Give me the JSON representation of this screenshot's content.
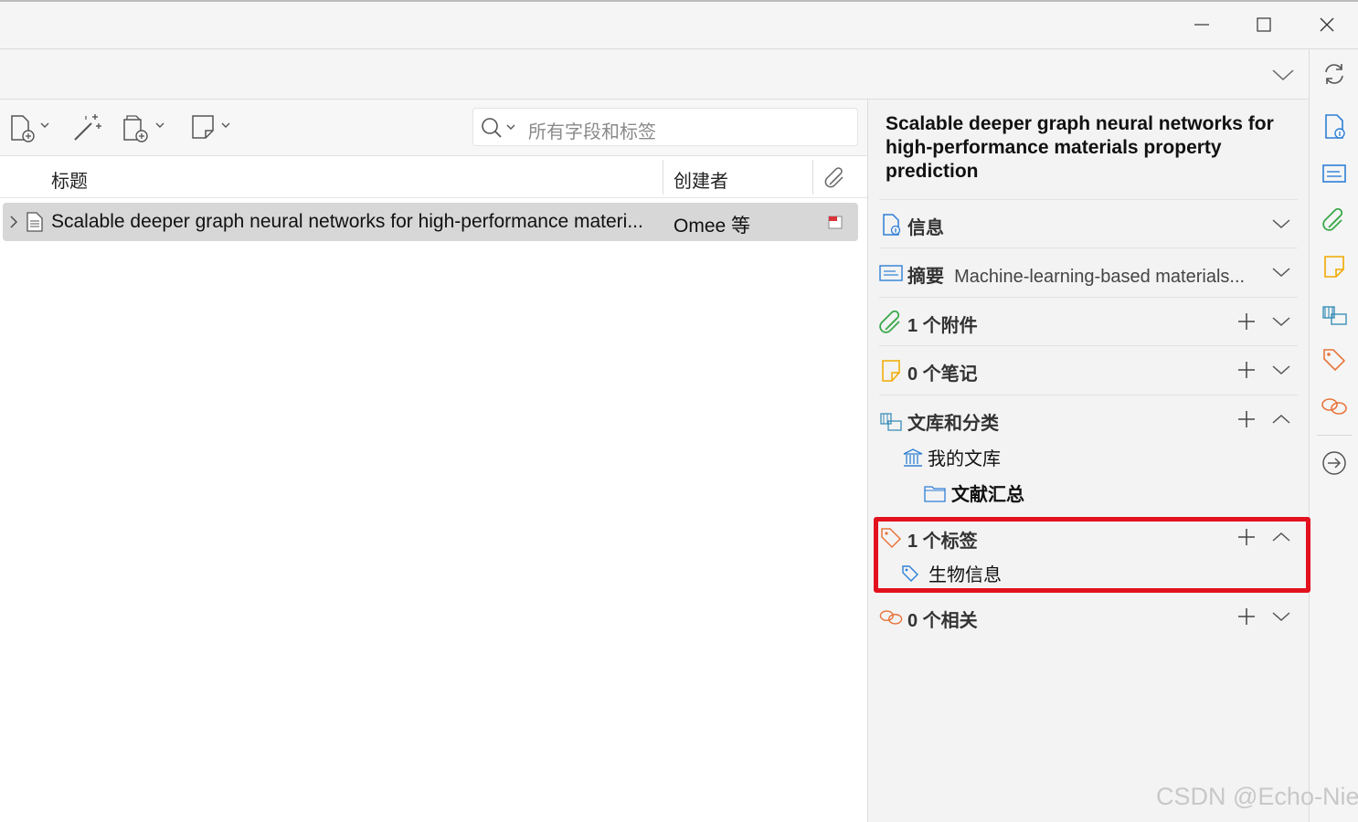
{
  "window": {
    "minimize_icon": "minimize-icon",
    "maximize_icon": "maximize-icon",
    "close_icon": "close-icon"
  },
  "toolbar": {
    "new_item_icon": "new-item-icon",
    "magic_wand_icon": "add-by-identifier-icon",
    "add_attachment_icon": "add-attachment-icon",
    "new_note_icon": "new-note-icon",
    "search_placeholder": "所有字段和标签"
  },
  "columns": {
    "title": "标题",
    "creator": "创建者",
    "attachment_icon": "paperclip-icon"
  },
  "items": [
    {
      "title": "Scalable deeper graph neural networks for high-performance materi...",
      "creator": "Omee 等"
    }
  ],
  "item_pane": {
    "title": "Scalable deeper graph neural networks for high-performance materials property prediction",
    "sections": {
      "info": {
        "label": "信息"
      },
      "abstract": {
        "label": "摘要",
        "preview": "Machine-learning-based materials..."
      },
      "attachments": {
        "label": "1 个附件"
      },
      "notes": {
        "label": "0 个笔记"
      },
      "libraries": {
        "label": "文库和分类",
        "library": "我的文库",
        "collection": "文献汇总"
      },
      "tags": {
        "label": "1 个标签",
        "tag": "生物信息"
      },
      "related": {
        "label": "0 个相关"
      }
    }
  },
  "colors": {
    "highlight": "#e3101d",
    "accent_blue": "#2e7fd6",
    "attach_green": "#3aa84a",
    "note_yellow": "#f2a900",
    "tag_orange": "#e8743b"
  },
  "watermark": "CSDN @Echo-Nie"
}
